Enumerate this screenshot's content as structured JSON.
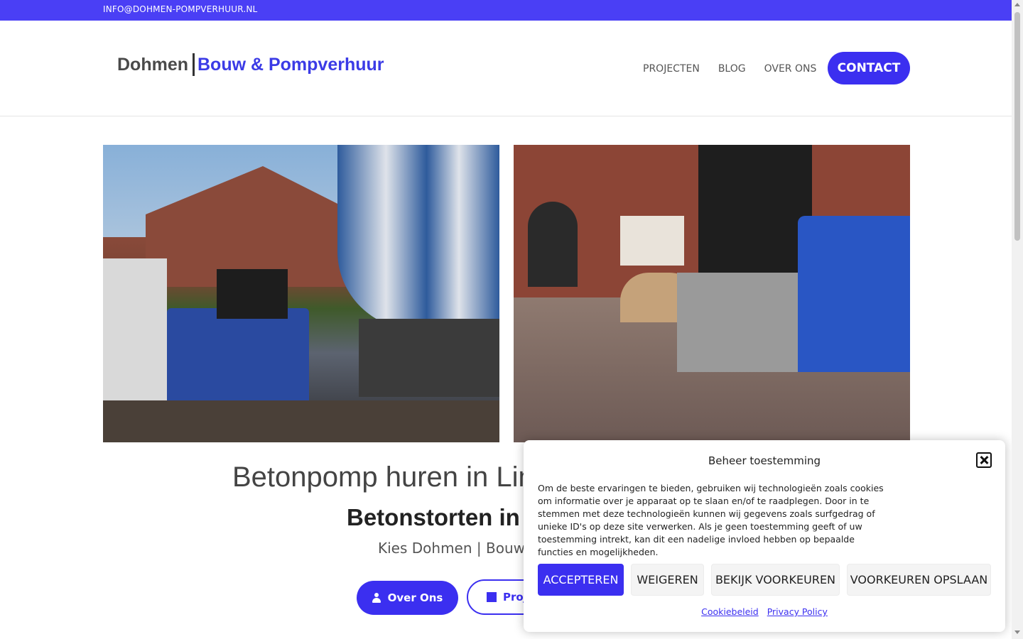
{
  "topbar": {
    "email": "INFO@DOHMEN-POMPVERHUUR.NL"
  },
  "header": {
    "logo_part1": "Dohmen",
    "logo_part2": "Bouw & Pompverhuur",
    "nav": [
      {
        "label": "PROJECTEN"
      },
      {
        "label": "BLOG"
      },
      {
        "label": "OVER ONS"
      }
    ],
    "contact_label": "CONTACT"
  },
  "hero": {
    "title": "Betonpomp huren in Limb",
    "subtitle": "Betonstorten in",
    "line": "Kies Dohmen | Bouw",
    "button_over": "Over Ons",
    "button_proj": "Proje"
  },
  "consent": {
    "title": "Beheer toestemming",
    "message": "Om de beste ervaringen te bieden, gebruiken wij technologieën zoals cookies om informatie over je apparaat op te slaan en/of te raadplegen. Door in te stemmen met deze technologieën kunnen wij gegevens zoals surfgedrag of unieke ID's op deze site verwerken. Als je geen toestemming geeft of uw toestemming intrekt, kan dit een nadelige invloed hebben op bepaalde functies en mogelijkheden.",
    "accept": "ACCEPTEREN",
    "deny": "WEIGEREN",
    "view_prefs": "BEKIJK VOORKEUREN",
    "save_prefs": "VOORKEUREN OPSLAAN",
    "link_cookie": "Cookiebeleid",
    "link_privacy": "Privacy Policy"
  },
  "colors": {
    "accent": "#3b2ff0",
    "topbar": "#4a3ff5"
  },
  "icons": {
    "over_ons": "user-icon",
    "projecten": "building-icon",
    "close": "close-icon"
  }
}
